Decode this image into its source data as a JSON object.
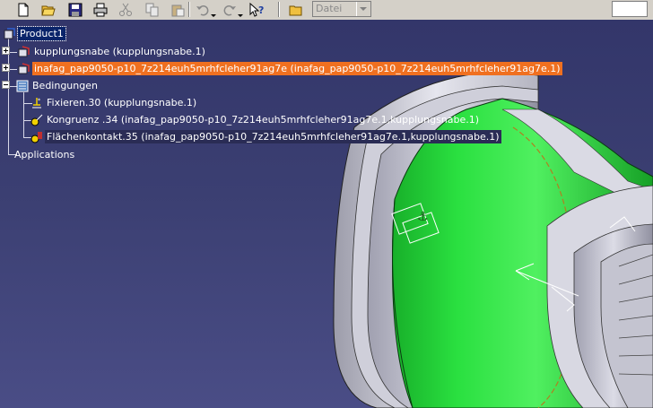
{
  "toolbar": {
    "buttons": [
      "new-icon",
      "open-icon",
      "save-icon",
      "print-icon",
      "cut-icon",
      "copy-icon",
      "paste-icon",
      "undo-icon",
      "redo-icon",
      "whats-this-icon",
      "open-folder-icon"
    ],
    "file_select_value": "Datei"
  },
  "tree": {
    "root": "Product1",
    "items": [
      {
        "label": "kupplungsnabe (kupplungsnabe.1)"
      },
      {
        "label": "inafag_pap9050-p10_7z214euh5mrhfcleher91ag7e (inafag_pap9050-p10_7z214euh5mrhfcleher91ag7e.1)"
      },
      {
        "label": "Bedingungen"
      },
      {
        "label": "Fixieren.30 (kupplungsnabe.1)"
      },
      {
        "label": "Kongruenz .34 (inafag_pap9050-p10_7z214euh5mrhfcleher91ag7e.1,kupplungsnabe.1)"
      },
      {
        "label": "Flächenkontakt.35 (inafag_pap9050-p10_7z214euh5mrhfcleher91ag7e.1,kupplungsnabe.1)"
      },
      {
        "label": "Applications"
      }
    ]
  },
  "colors": {
    "background": "#3b3f6e",
    "selection_orange": "#f07020",
    "part_green": "#22e03a",
    "part_gray": "#c8c8d2"
  }
}
